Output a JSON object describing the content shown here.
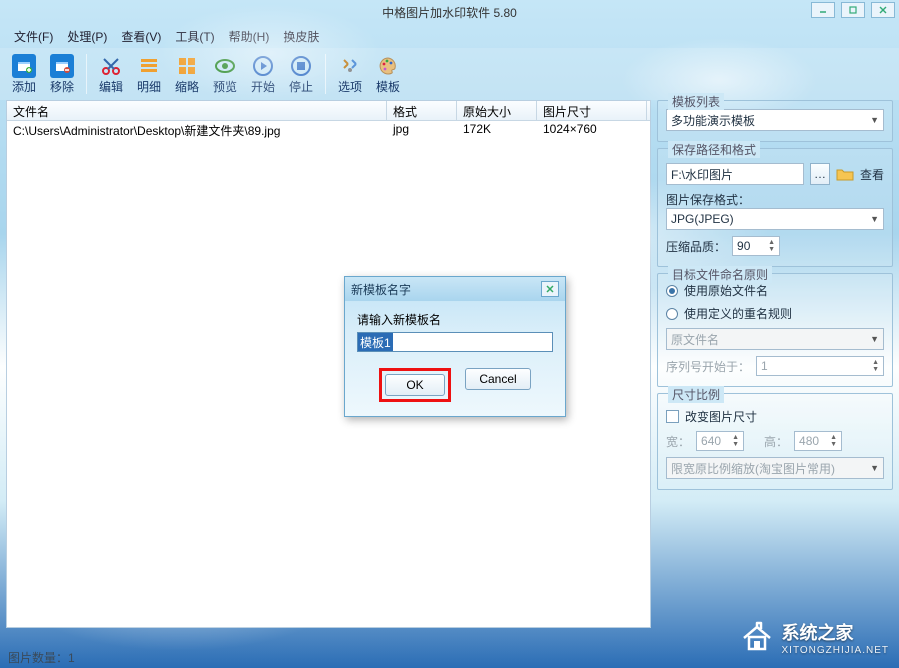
{
  "window": {
    "title": "中格图片加水印软件 5.80"
  },
  "menu": {
    "file": "文件(F)",
    "process": "处理(P)",
    "view": "查看(V)",
    "tools": "工具(T)",
    "help": "帮助(H)",
    "skin": "换皮肤"
  },
  "toolbar": {
    "add": "添加",
    "remove": "移除",
    "edit": "编辑",
    "detail": "明细",
    "thumb": "缩略",
    "preview": "预览",
    "start": "开始",
    "stop": "停止",
    "options": "选项",
    "template": "模板"
  },
  "list": {
    "headers": {
      "name": "文件名",
      "fmt": "格式",
      "raw": "原始大小",
      "dim": "图片尺寸"
    },
    "rows": [
      {
        "name": "C:\\Users\\Administrator\\Desktop\\新建文件夹\\89.jpg",
        "fmt": "jpg",
        "raw": "172K",
        "dim": "1024×760"
      }
    ]
  },
  "side": {
    "template_list_title": "模板列表",
    "template_selected": "多功能演示模板",
    "save_group_title": "保存路径和格式",
    "save_path": "F:\\水印图片",
    "browse_label": "查看",
    "save_fmt_label": "图片保存格式：",
    "save_fmt_value": "JPG(JPEG)",
    "quality_label": "压缩品质：",
    "quality_value": "90",
    "naming_title": "目标文件命名原则",
    "naming_use_original": "使用原始文件名",
    "naming_use_custom": "使用定义的重名规则",
    "naming_placeholder": "原文件名",
    "seq_label": "序列号开始于：",
    "seq_value": "1",
    "size_title": "尺寸比例",
    "size_change_label": "改变图片尺寸",
    "width_label": "宽：",
    "width_value": "640",
    "height_label": "高：",
    "height_value": "480",
    "scale_mode": "限宽原比例缩放(淘宝图片常用)"
  },
  "dialog": {
    "title": "新模板名字",
    "prompt": "请输入新模板名",
    "input_value": "模板1",
    "ok": "OK",
    "cancel": "Cancel"
  },
  "status": {
    "count_label": "图片数量：1"
  },
  "watermark": {
    "brand": "系统之家",
    "url": "XITONGZHIJIA.NET"
  }
}
